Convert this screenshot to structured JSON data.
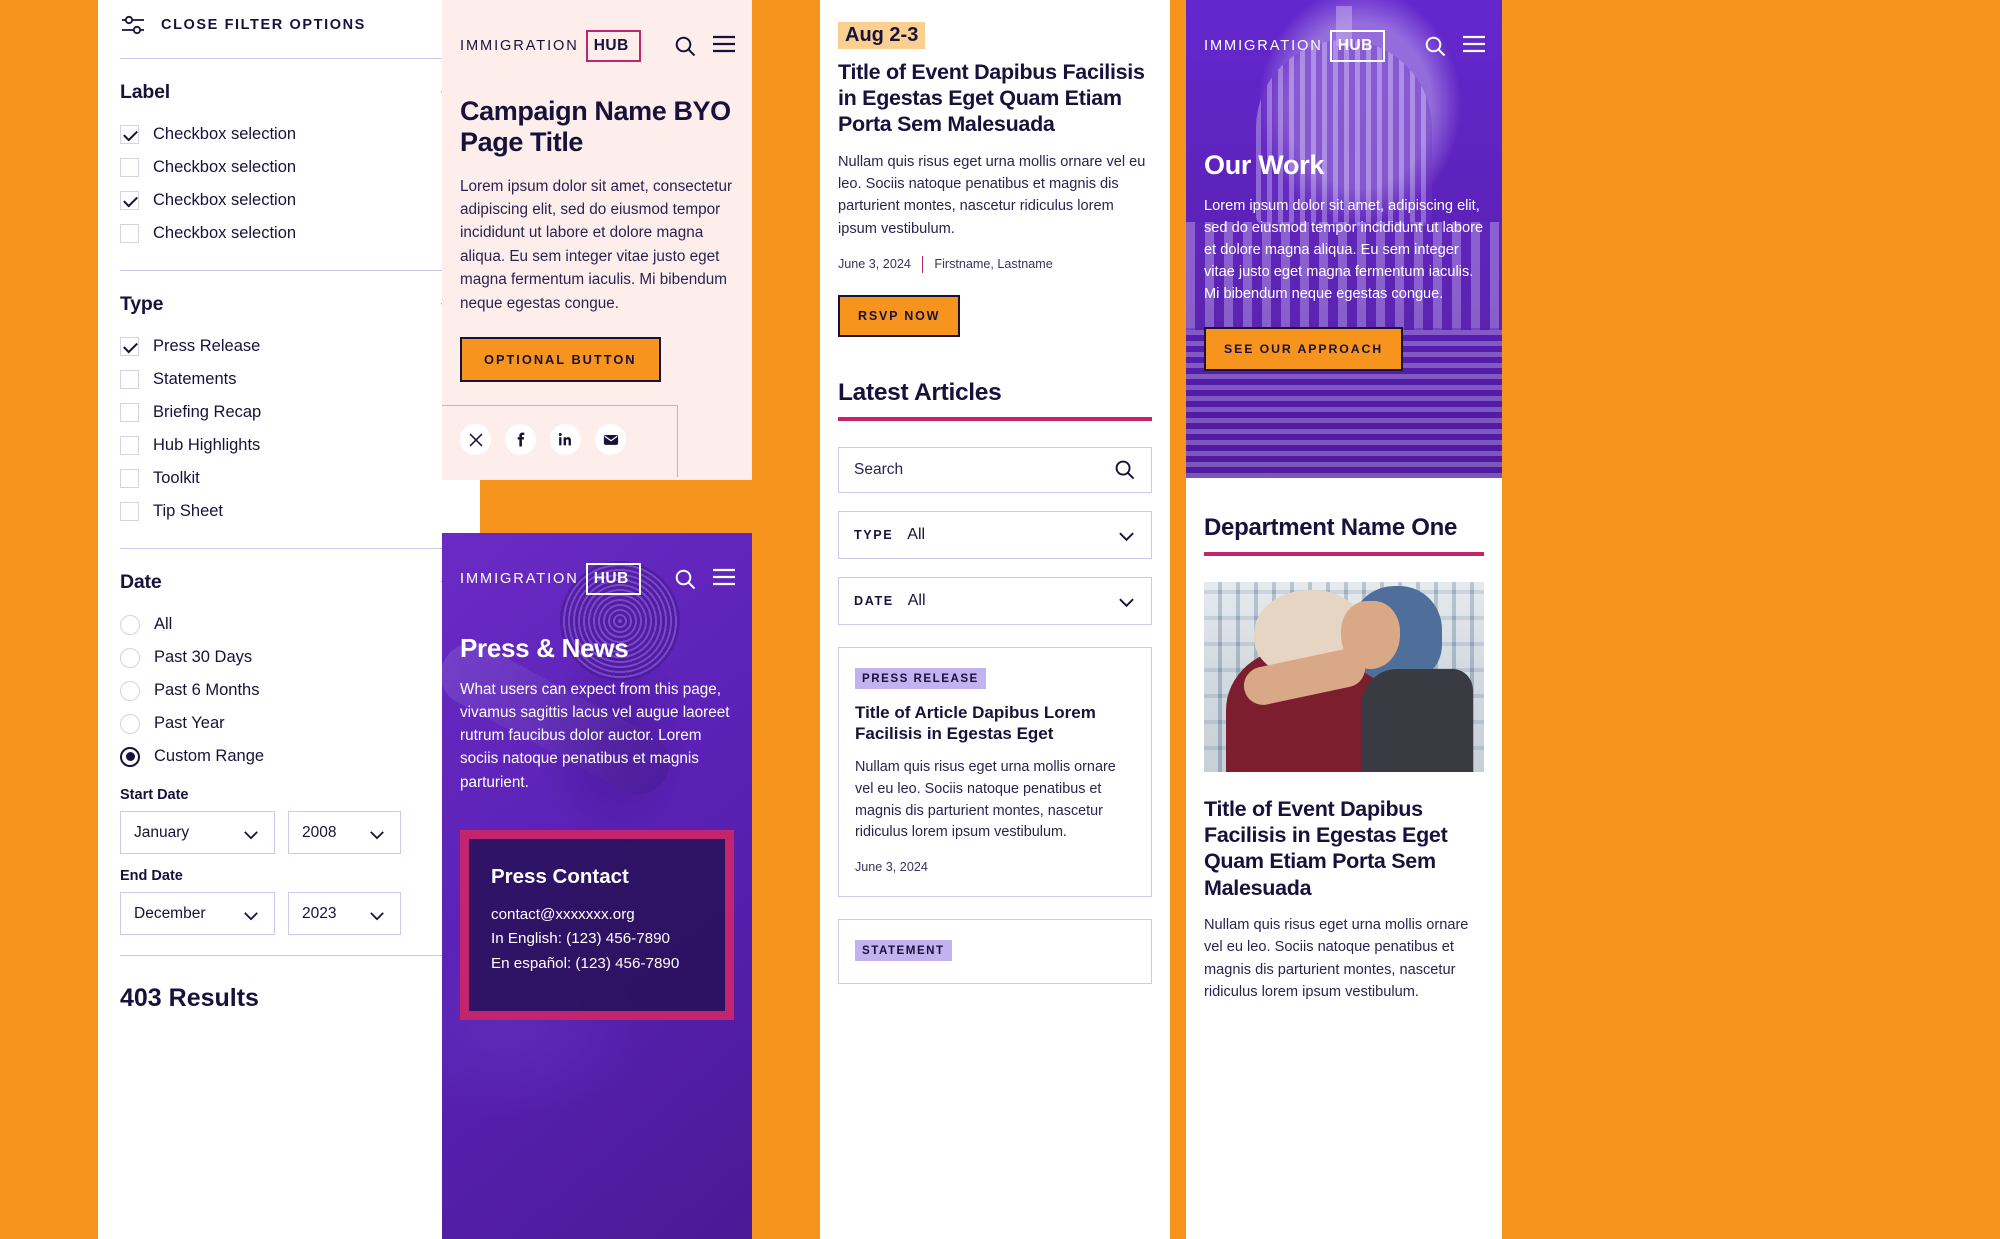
{
  "colors": {
    "background_orange": "#F7941E",
    "brand_navy": "#17123b",
    "brand_pink": "#C2256E",
    "brand_purple": "#5B21B6",
    "badge_lavender": "#C4B2F0",
    "chip_tan": "#FBCF8F",
    "panel_blush": "#FDEEEC",
    "border_lavender": "#cfc8ee"
  },
  "filters": {
    "header_label": "CLOSE FILTER OPTIONS",
    "header_icon": "sliders-icon",
    "groups": [
      {
        "title": "Label",
        "control": "checkbox",
        "items": [
          {
            "label": "Checkbox selection",
            "checked": true
          },
          {
            "label": "Checkbox selection",
            "checked": false
          },
          {
            "label": "Checkbox selection",
            "checked": true
          },
          {
            "label": "Checkbox selection",
            "checked": false
          }
        ]
      },
      {
        "title": "Type",
        "control": "checkbox",
        "items": [
          {
            "label": "Press Release",
            "checked": true
          },
          {
            "label": "Statements",
            "checked": false
          },
          {
            "label": "Briefing Recap",
            "checked": false
          },
          {
            "label": "Hub Highlights",
            "checked": false
          },
          {
            "label": "Toolkit",
            "checked": false
          },
          {
            "label": "Tip Sheet",
            "checked": false
          }
        ]
      },
      {
        "title": "Date",
        "control": "radio",
        "items": [
          {
            "label": "All",
            "checked": false
          },
          {
            "label": "Past 30 Days",
            "checked": false
          },
          {
            "label": "Past 6 Months",
            "checked": false
          },
          {
            "label": "Past Year",
            "checked": false
          },
          {
            "label": "Custom Range",
            "checked": true
          }
        ]
      }
    ],
    "start_date_label": "Start Date",
    "start_month": "January",
    "start_year": "2008",
    "end_date_label": "End Date",
    "end_month": "December",
    "end_year": "2023",
    "results_count": "403 Results"
  },
  "campaign": {
    "logo_word": "IMMIGRATION",
    "logo_mark": "HUB",
    "title": "Campaign Name BYO Page Title",
    "paragraph": "Lorem ipsum dolor sit amet, consectetur adipiscing elit, sed do eiusmod tempor incididunt ut labore et dolore magna aliqua. Eu sem integer vitae justo eget magna fermentum iaculis. Mi bibendum neque egestas congue.",
    "button_label": "OPTIONAL BUTTON",
    "social": [
      "x-icon",
      "facebook-icon",
      "linkedin-icon",
      "email-icon"
    ]
  },
  "press": {
    "logo_word": "IMMIGRATION",
    "logo_mark": "HUB",
    "title": "Press & News",
    "paragraph": "What users can expect from this page, vivamus sagittis lacus vel augue laoreet rutrum faucibus dolor auctor. Lorem sociis natoque penatibus et magnis parturient.",
    "contact_heading": "Press Contact",
    "contact_email": "contact@xxxxxxx.org",
    "contact_english": "In English: (123) 456-7890",
    "contact_spanish": "En español: (123) 456-7890"
  },
  "event": {
    "date_chip": "Aug 2-3",
    "title": "Title of Event Dapibus Facilisis in Egestas Eget Quam Etiam Porta Sem Malesuada",
    "paragraph": "Nullam quis risus eget urna mollis ornare vel eu leo. Sociis natoque penatibus et magnis dis parturient montes, nascetur ridiculus lorem ipsum vestibulum.",
    "byline_date": "June 3, 2024",
    "byline_author": "Firstname, Lastname",
    "button_label": "RSVP NOW"
  },
  "articles": {
    "section_title": "Latest Articles",
    "search_placeholder": "Search",
    "search_icon": "search-icon",
    "filters": [
      {
        "key": "TYPE",
        "value": "All"
      },
      {
        "key": "DATE",
        "value": "All"
      }
    ],
    "cards": [
      {
        "badge": "PRESS RELEASE",
        "title": "Title of Article Dapibus Lorem Facilisis in Egestas Eget",
        "paragraph": "Nullam quis risus eget urna mollis ornare vel eu leo. Sociis natoque penatibus et magnis dis parturient montes, nascetur ridiculus lorem ipsum vestibulum.",
        "date": "June 3, 2024"
      },
      {
        "badge": "STATEMENT",
        "title": "",
        "paragraph": "",
        "date": ""
      }
    ]
  },
  "work": {
    "logo_word": "IMMIGRATION",
    "logo_mark": "HUB",
    "title": "Our Work",
    "paragraph": "Lorem ipsum dolor sit amet, adipiscing elit, sed do eiusmod tempor incididunt ut labore et dolore magna aliqua. Eu sem integer vitae justo eget magna fermentum iaculis. Mi bibendum neque egestas congue.",
    "button_label": "SEE OUR APPROACH",
    "department_heading": "Department Name One",
    "photo_alt": "two-women-hugging-photo",
    "event_title": "Title of Event Dapibus Facilisis in Egestas Eget Quam Etiam Porta Sem Malesuada",
    "event_paragraph": "Nullam quis risus eget urna mollis ornare vel eu leo. Sociis natoque penatibus et magnis dis parturient montes, nascetur ridiculus lorem ipsum vestibulum."
  }
}
